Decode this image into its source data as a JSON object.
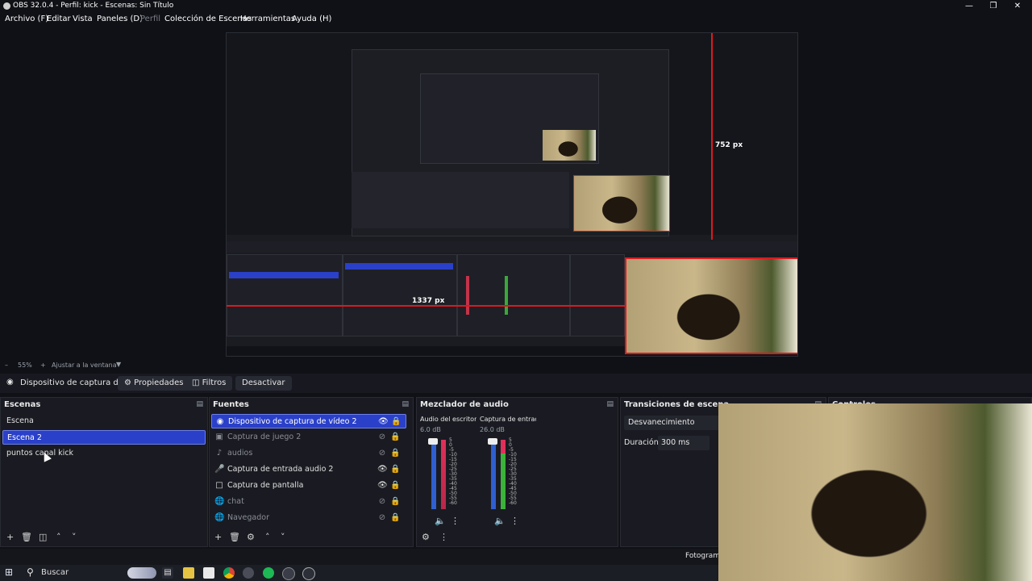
{
  "window": {
    "title": "OBS 32.0.4 - Perfil: kick - Escenas: Sin Título",
    "controls": [
      "minimize-icon",
      "restore-icon",
      "close-icon"
    ]
  },
  "menu": [
    {
      "label": "Archivo (F)",
      "enabled": true
    },
    {
      "label": "Editar",
      "enabled": true
    },
    {
      "label": "Vista",
      "enabled": true
    },
    {
      "label": "Paneles (D)",
      "enabled": true
    },
    {
      "label": "Perfil",
      "enabled": false
    },
    {
      "label": "Colección de Escenas",
      "enabled": true
    },
    {
      "label": "Herramientas",
      "enabled": true
    },
    {
      "label": "Ayuda (H)",
      "enabled": true
    }
  ],
  "preview": {
    "height_label": "752 px",
    "width_label": "1337 px"
  },
  "zoom": {
    "value": "55%",
    "fit_label": "Ajustar a la ventana"
  },
  "source_toolbar": {
    "source_name": "Dispositivo de captura de v",
    "properties": "Propiedades",
    "filters": "Filtros",
    "deactivate": "Desactivar"
  },
  "scenes": {
    "title": "Escenas",
    "items": [
      {
        "label": "Escena",
        "selected": false
      },
      {
        "label": "Escena 2",
        "selected": true
      },
      {
        "label": "puntos canal kick",
        "selected": false
      }
    ]
  },
  "sources": {
    "title": "Fuentes",
    "items": [
      {
        "label": "Dispositivo de captura de vídeo 2",
        "icon": "camera-icon",
        "visible": true,
        "selected": true
      },
      {
        "label": "Captura de juego 2",
        "icon": "gamepad-icon",
        "visible": false,
        "selected": false
      },
      {
        "label": "audios",
        "icon": "audio-icon",
        "visible": false,
        "selected": false
      },
      {
        "label": "Captura de entrada audio 2",
        "icon": "microphone-icon",
        "visible": true,
        "selected": false
      },
      {
        "label": "Captura de pantalla",
        "icon": "monitor-icon",
        "visible": true,
        "selected": false
      },
      {
        "label": "chat",
        "icon": "globe-icon",
        "visible": false,
        "selected": false
      },
      {
        "label": "Navegador",
        "icon": "globe-icon",
        "visible": false,
        "selected": false
      }
    ]
  },
  "mixer": {
    "title": "Mezclador de audio",
    "channels": [
      {
        "name": "Audio del escritorio",
        "db": "6.0 dB"
      },
      {
        "name": "Captura de entrada",
        "db": "26.0 dB"
      }
    ],
    "scale": [
      "5",
      "0",
      "-5",
      "-10",
      "-15",
      "-20",
      "-25",
      "-30",
      "-35",
      "-40",
      "-45",
      "-50",
      "-55",
      "-60"
    ]
  },
  "transitions": {
    "title": "Transiciones de escena",
    "type": "Desvanecimiento",
    "duration_label": "Duración",
    "duration_value": "300 ms"
  },
  "controls": {
    "title": "Controles"
  },
  "status": {
    "frames_label": "Fotogram"
  },
  "taskbar": {
    "search_placeholder": "Buscar"
  },
  "colors": {
    "accent": "#2a40c9",
    "background": "#101116",
    "dock": "#1a1b22",
    "guide_red": "#e0181e"
  }
}
